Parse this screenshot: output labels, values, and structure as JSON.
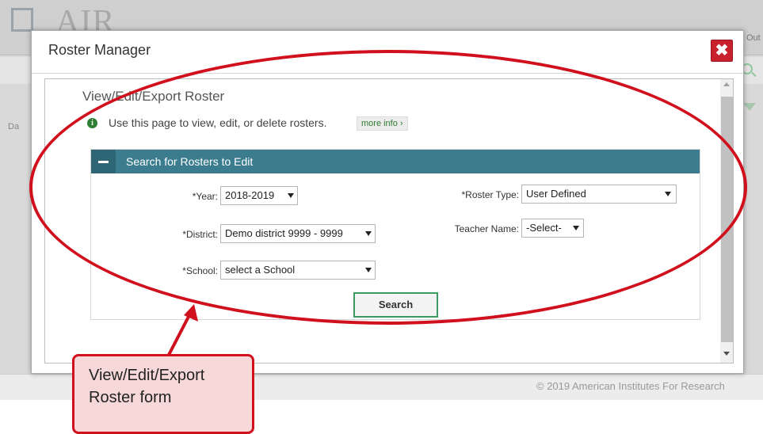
{
  "background": {
    "logo_text": "AIR",
    "header_link": "Out",
    "subbar_text": "Da",
    "copyright": "© 2019 American Institutes For Research"
  },
  "modal": {
    "title": "Roster Manager",
    "close_label": "✖",
    "section_title": "View/Edit/Export Roster",
    "info_text": "Use this page to view, edit, or delete rosters.",
    "more_info_label": "more info ›",
    "panel": {
      "title": "Search for Rosters to Edit",
      "fields": {
        "year": {
          "label": "*Year:",
          "value": "2018-2019"
        },
        "district": {
          "label": "*District:",
          "value": "Demo district 9999 - 9999"
        },
        "school": {
          "label": "*School:",
          "value": "select a School"
        },
        "roster_type": {
          "label": "*Roster Type:",
          "value": "User Defined"
        },
        "teacher_name": {
          "label": "Teacher Name:",
          "value": "-Select-"
        }
      },
      "search_button": "Search"
    }
  },
  "annotation": {
    "callout_line1": "View/Edit/Export",
    "callout_line2": "Roster form",
    "color": "#d0101c"
  }
}
